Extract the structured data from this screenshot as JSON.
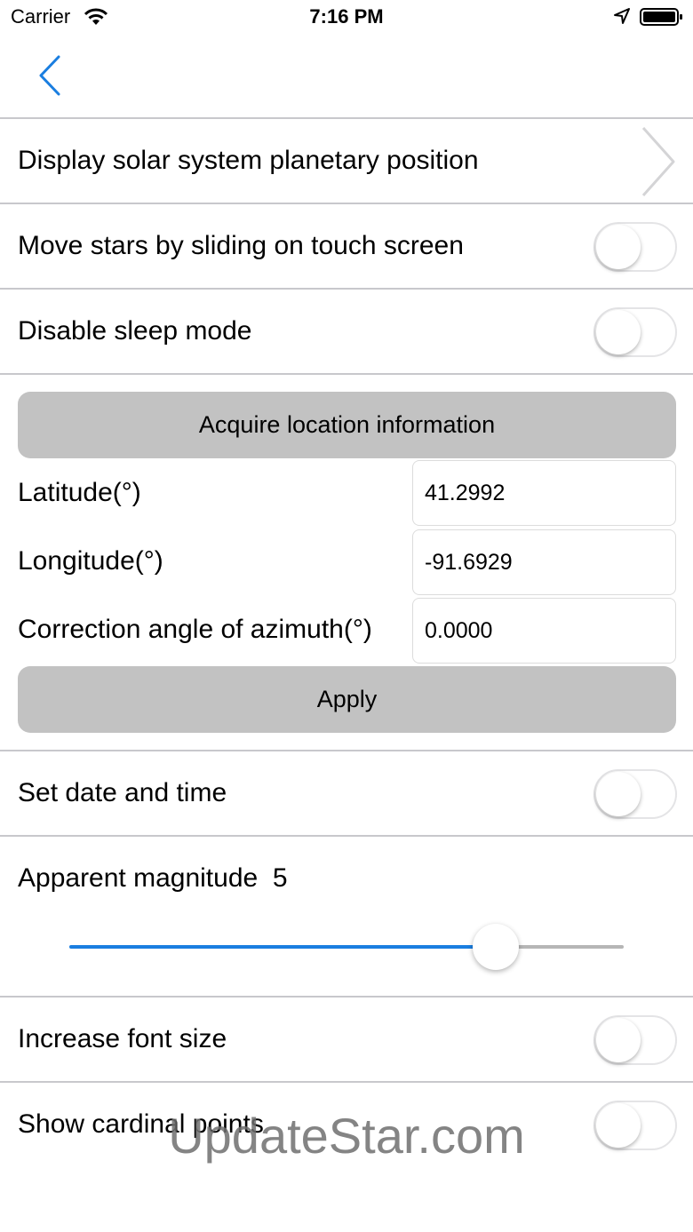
{
  "status_bar": {
    "carrier": "Carrier",
    "time": "7:16 PM"
  },
  "nav": {
    "back_icon": "chevron-left-icon"
  },
  "rows": {
    "solar": {
      "label": "Display solar system planetary position",
      "icon": "chevron-right-icon"
    },
    "move_stars": {
      "label": "Move stars by sliding on touch screen",
      "on": false
    },
    "sleep": {
      "label": "Disable sleep mode",
      "on": false
    }
  },
  "location": {
    "acquire_label": "Acquire location information",
    "latitude_label": "Latitude(°)",
    "latitude_value": "41.2992",
    "longitude_label": "Longitude(°)",
    "longitude_value": "-91.6929",
    "azimuth_label": "Correction angle of azimuth(°)",
    "azimuth_value": "0.0000",
    "apply_label": "Apply"
  },
  "date_time": {
    "label": "Set date and time",
    "on": false
  },
  "magnitude": {
    "label": "Apparent magnitude",
    "value": "5",
    "fill_fraction": 0.77
  },
  "font_size": {
    "label": "Increase font size",
    "on": false
  },
  "cardinal": {
    "label": "Show cardinal points",
    "on": false
  },
  "watermark": "UpdateStar.com",
  "colors": {
    "accent": "#1a7ee0",
    "button_gray": "#c2c2c2",
    "separator": "#c8c8cc"
  }
}
